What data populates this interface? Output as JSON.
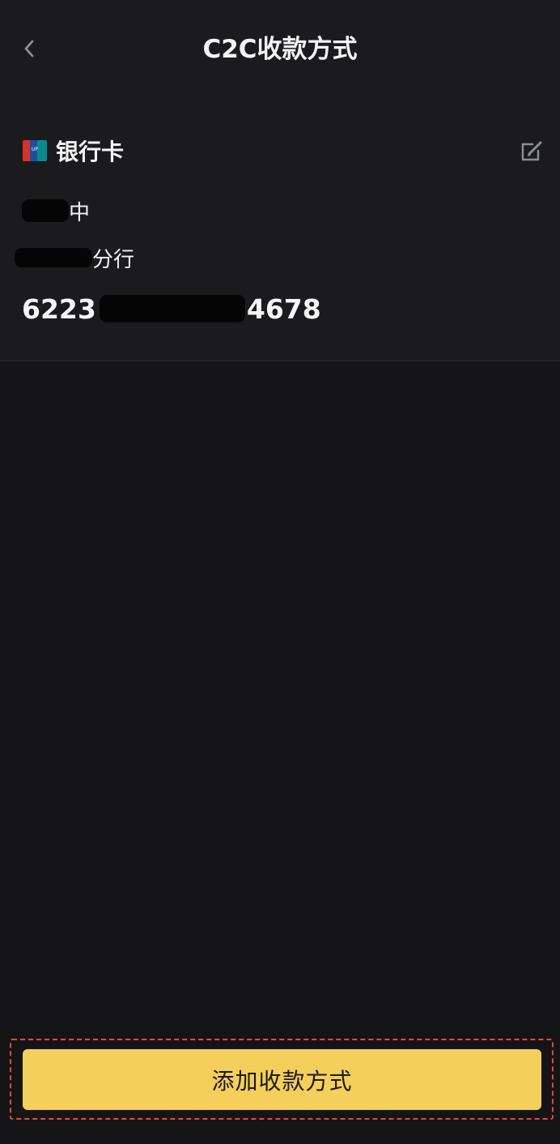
{
  "header": {
    "title": "C2C收款方式",
    "back_icon": "chevron-left-icon"
  },
  "payment_method": {
    "type_label": "银行卡",
    "type_icon": "unionpay-icon",
    "edit_icon": "edit-icon",
    "bank_name_suffix": "中",
    "branch_suffix": "分行",
    "card_number_prefix": "6223",
    "card_number_suffix": "4678"
  },
  "footer": {
    "add_button_label": "添加收款方式"
  },
  "colors": {
    "background": "#151517",
    "panel": "#1b1b1e",
    "accent": "#f5cf5b",
    "highlight_border": "#e54a2d"
  }
}
